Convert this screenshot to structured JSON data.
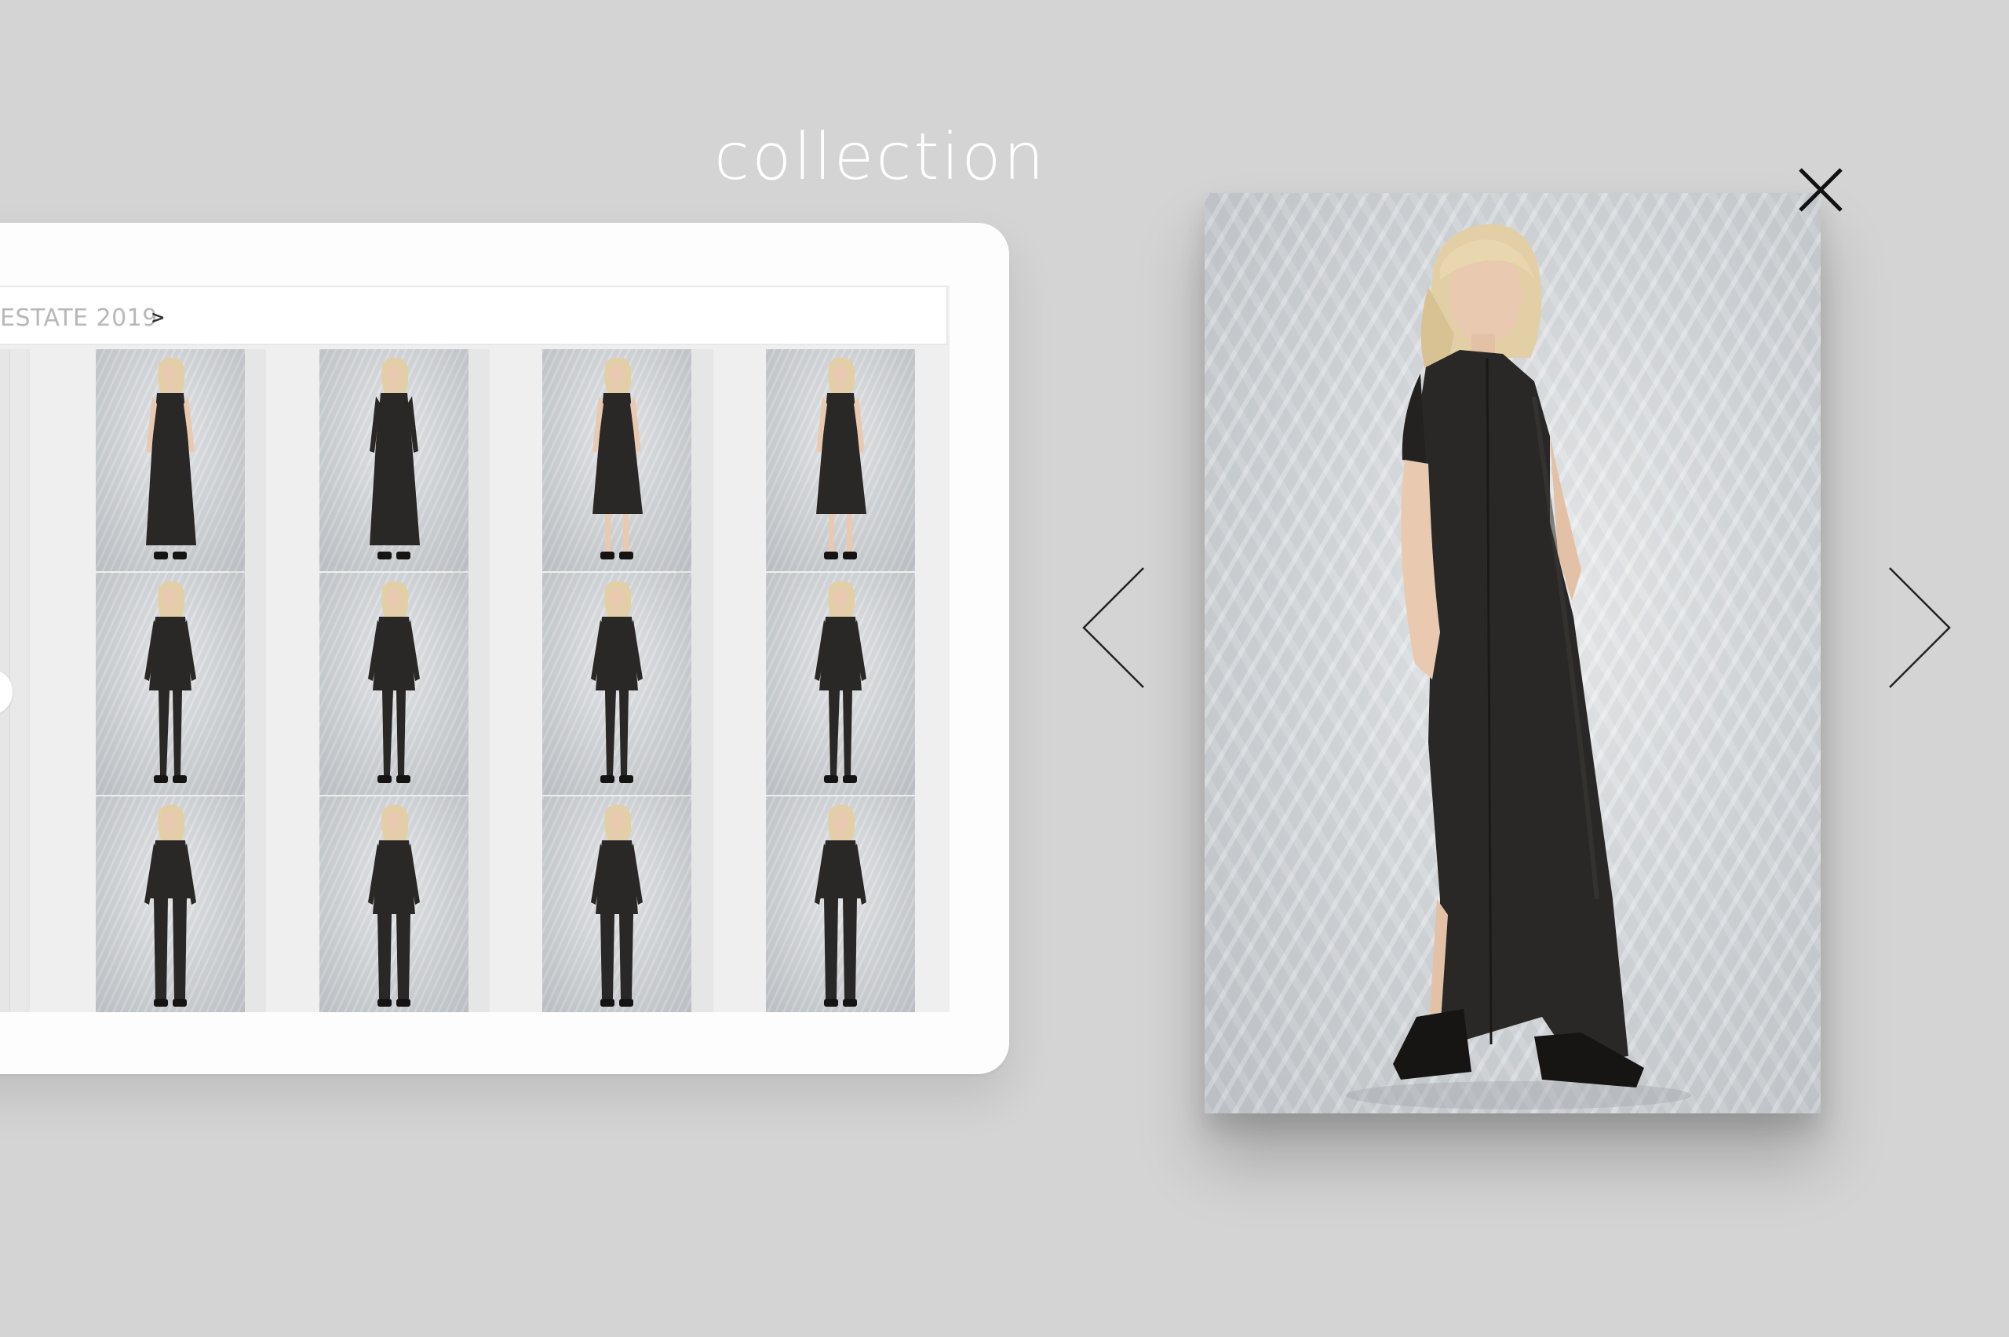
{
  "header": {
    "title": "collection"
  },
  "gallery": {
    "breadcrumb": "ESTATE 2019",
    "breadcrumb_arrow": ">",
    "thumbnails": [
      {
        "row": 1,
        "col": 1,
        "outfit": "sleeveless-jumpsuit"
      },
      {
        "row": 1,
        "col": 2,
        "outfit": "belted-coat-dress"
      },
      {
        "row": 1,
        "col": 3,
        "outfit": "sleeveless-midi-dress"
      },
      {
        "row": 1,
        "col": 4,
        "outfit": "halter-dress"
      },
      {
        "row": 2,
        "col": 1,
        "outfit": "draped-tunic-leggings"
      },
      {
        "row": 2,
        "col": 2,
        "outfit": "asymmetric-tunic-leggings"
      },
      {
        "row": 2,
        "col": 3,
        "outfit": "cold-shoulder-shirt-leggings"
      },
      {
        "row": 2,
        "col": 4,
        "outfit": "cold-shoulder-shirt-back-view"
      },
      {
        "row": 3,
        "col": 1,
        "outfit": "cowl-top-trousers"
      },
      {
        "row": 3,
        "col": 2,
        "outfit": "oversized-shirt-trousers"
      },
      {
        "row": 3,
        "col": 3,
        "outfit": "shirt-wide-trousers"
      },
      {
        "row": 3,
        "col": 4,
        "outfit": "tee-cropped-trousers"
      }
    ]
  },
  "lightbox": {
    "image": "model-long-sleeveless-black-dress",
    "close_icon": "close-icon",
    "prev_icon": "chevron-left-icon",
    "next_icon": "chevron-right-icon"
  },
  "colors": {
    "background": "#d4d4d4",
    "title": "#ffffff",
    "garment": "#2a2826",
    "hair": "#e2cfa6",
    "skin": "#e9c9b0"
  }
}
